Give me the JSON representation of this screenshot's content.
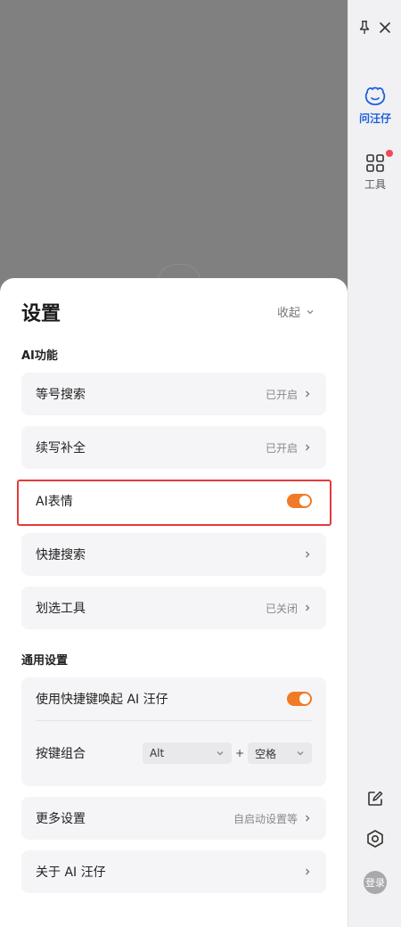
{
  "sidebar": {
    "items": [
      {
        "label": "问汪仔",
        "icon": "mascot-icon"
      },
      {
        "label": "工具",
        "icon": "grid-icon"
      }
    ],
    "login_label": "登录"
  },
  "settings": {
    "title": "设置",
    "collapse_label": "收起",
    "ai_section_title": "AI功能",
    "ai_rows": [
      {
        "label": "等号搜索",
        "status": "已开启"
      },
      {
        "label": "续写补全",
        "status": "已开启"
      },
      {
        "label": "AI表情",
        "toggle": true
      },
      {
        "label": "快捷搜索",
        "status": ""
      },
      {
        "label": "划选工具",
        "status": "已关闭"
      }
    ],
    "general_section_title": "通用设置",
    "shortcut": {
      "label": "使用快捷键唤起 AI 汪仔",
      "enabled": true,
      "combo_label": "按键组合",
      "key1": "Alt",
      "plus": "+",
      "key2": "空格"
    },
    "more_settings": {
      "label": "更多设置",
      "status": "自启动设置等"
    },
    "about": {
      "label": "关于 AI 汪仔"
    }
  },
  "colors": {
    "accent": "#f07a26",
    "active_blue": "#1e5fe0",
    "highlight_red": "#e53a3a",
    "notify_dot": "#f04a5a"
  }
}
